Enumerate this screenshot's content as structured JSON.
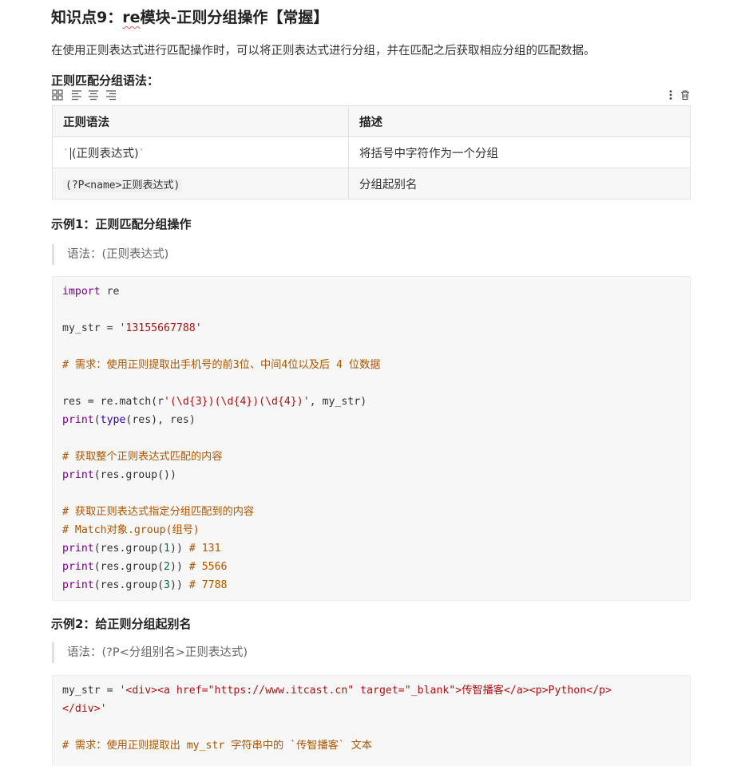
{
  "heading": {
    "prefix": "知识点9：",
    "module": "re",
    "suffix": "模块-正则分组操作【常握】"
  },
  "intro": "在使用正则表达式进行匹配操作时，可以将正则表达式进行分组，并在匹配之后获取相应分组的匹配数据。",
  "syntax_label": "正则匹配分组语法：",
  "table_toolbar": {
    "icons": [
      "grid-icon",
      "align-left-icon",
      "align-center-icon",
      "align-right-icon",
      "more-vertical-icon",
      "trash-icon"
    ]
  },
  "table": {
    "headers": [
      "正则语法",
      "描述"
    ],
    "rows": [
      {
        "syntax": "(正则表达式)",
        "desc": "将括号中字符作为一个分组"
      },
      {
        "syntax": "(?P<name>正则表达式)",
        "desc": "分组起别名"
      }
    ]
  },
  "example1": {
    "title": "示例1：正则匹配分组操作",
    "quote": "语法：(正则表达式)",
    "code": {
      "l1_kw": "import",
      "l1_rest": " re",
      "l3_a": "my_str = ",
      "l3_str": "'13155667788'",
      "l5_cm": "# 需求：使用正则提取出手机号的前3位、中间4位以及后 4 位数据",
      "l7_a": "res = re.match(r",
      "l7_str": "'(\\d{3})(\\d{4})(\\d{4})'",
      "l7_b": ", my_str)",
      "l8_kw": "print",
      "l8_a": "(",
      "l8_bi": "type",
      "l8_b": "(res), res)",
      "l10_cm": "# 获取整个正则表达式匹配的内容",
      "l11_kw": "print",
      "l11_a": "(res.group())",
      "l13_cm": "# 获取正则表达式指定分组匹配到的内容",
      "l14_cm": "# Match对象.group(组号)",
      "l15_kw": "print",
      "l15_a": "(res.group(",
      "l15_num": "1",
      "l15_b": ")) ",
      "l15_cm": "# 131",
      "l16_kw": "print",
      "l16_a": "(res.group(",
      "l16_num": "2",
      "l16_b": ")) ",
      "l16_cm": "# 5566",
      "l17_kw": "print",
      "l17_a": "(res.group(",
      "l17_num": "3",
      "l17_b": ")) ",
      "l17_cm": "# 7788"
    }
  },
  "example2": {
    "title": "示例2：给正则分组起别名",
    "quote": "语法：(?P<分组别名>正则表达式)",
    "code": {
      "l1_a": "my_str = ",
      "l1_str": "'<div><a href=\"https://www.itcast.cn\" target=\"_blank\">传智播客</a><p>Python</p>",
      "l2_str": "</div>'",
      "l4_cm": "# 需求：使用正则提取出 my_str 字符串中的 `传智播客` 文本"
    }
  },
  "colors": {
    "keyword": "#770088",
    "string": "#aa1111",
    "comment": "#aa5500",
    "builtin": "#3300aa",
    "number": "#116644",
    "code_bg": "#f7f7f8",
    "table_border": "#dfe2e5"
  }
}
